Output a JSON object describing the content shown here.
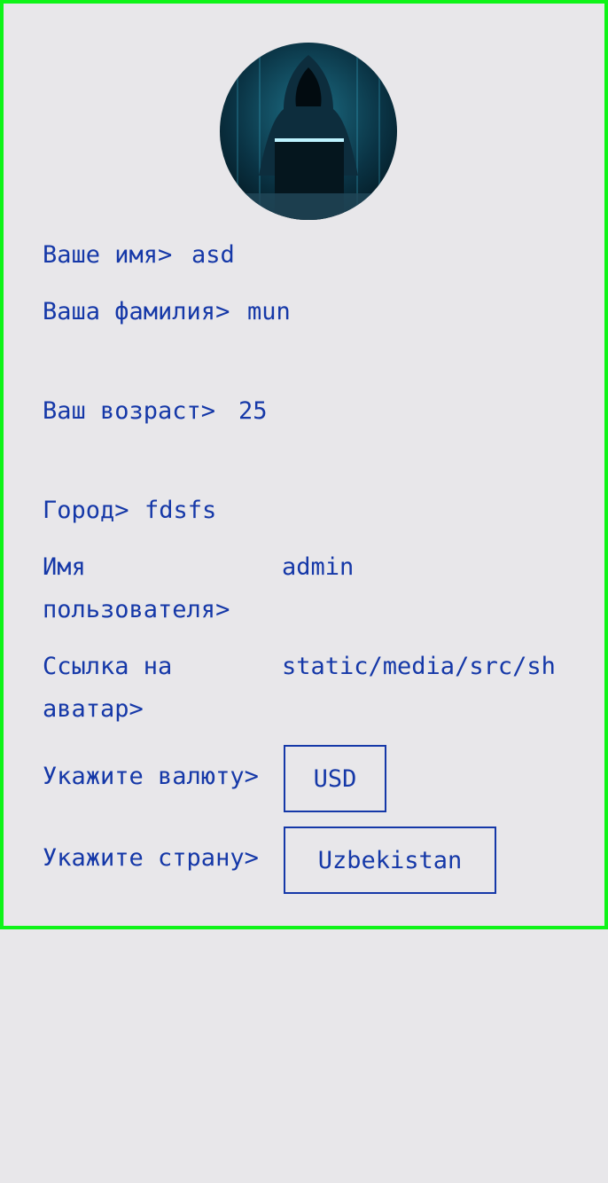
{
  "avatar": {
    "alt_icon": "hooded-hacker-avatar"
  },
  "fields": {
    "name": {
      "label": "Ваше имя>",
      "value": "asd"
    },
    "surname": {
      "label": "Ваша фамилия>",
      "value": "mun"
    },
    "age": {
      "label": "Ваш возраст>",
      "value": "25"
    },
    "city": {
      "label": "Город>",
      "value": "fdsfs"
    },
    "username": {
      "label": "Имя пользователя>",
      "value": "admin"
    },
    "avatar_link": {
      "label": "Ссылка на аватар>",
      "value": "static/media/src/sh"
    }
  },
  "currency": {
    "label": "Укажите валюту>",
    "value": "USD"
  },
  "country": {
    "label": "Укажите страну>",
    "value": "Uzbekistan"
  },
  "colors": {
    "text": "#1538a8",
    "border_highlight": "#0ef418",
    "background": "#e8e7ea"
  }
}
